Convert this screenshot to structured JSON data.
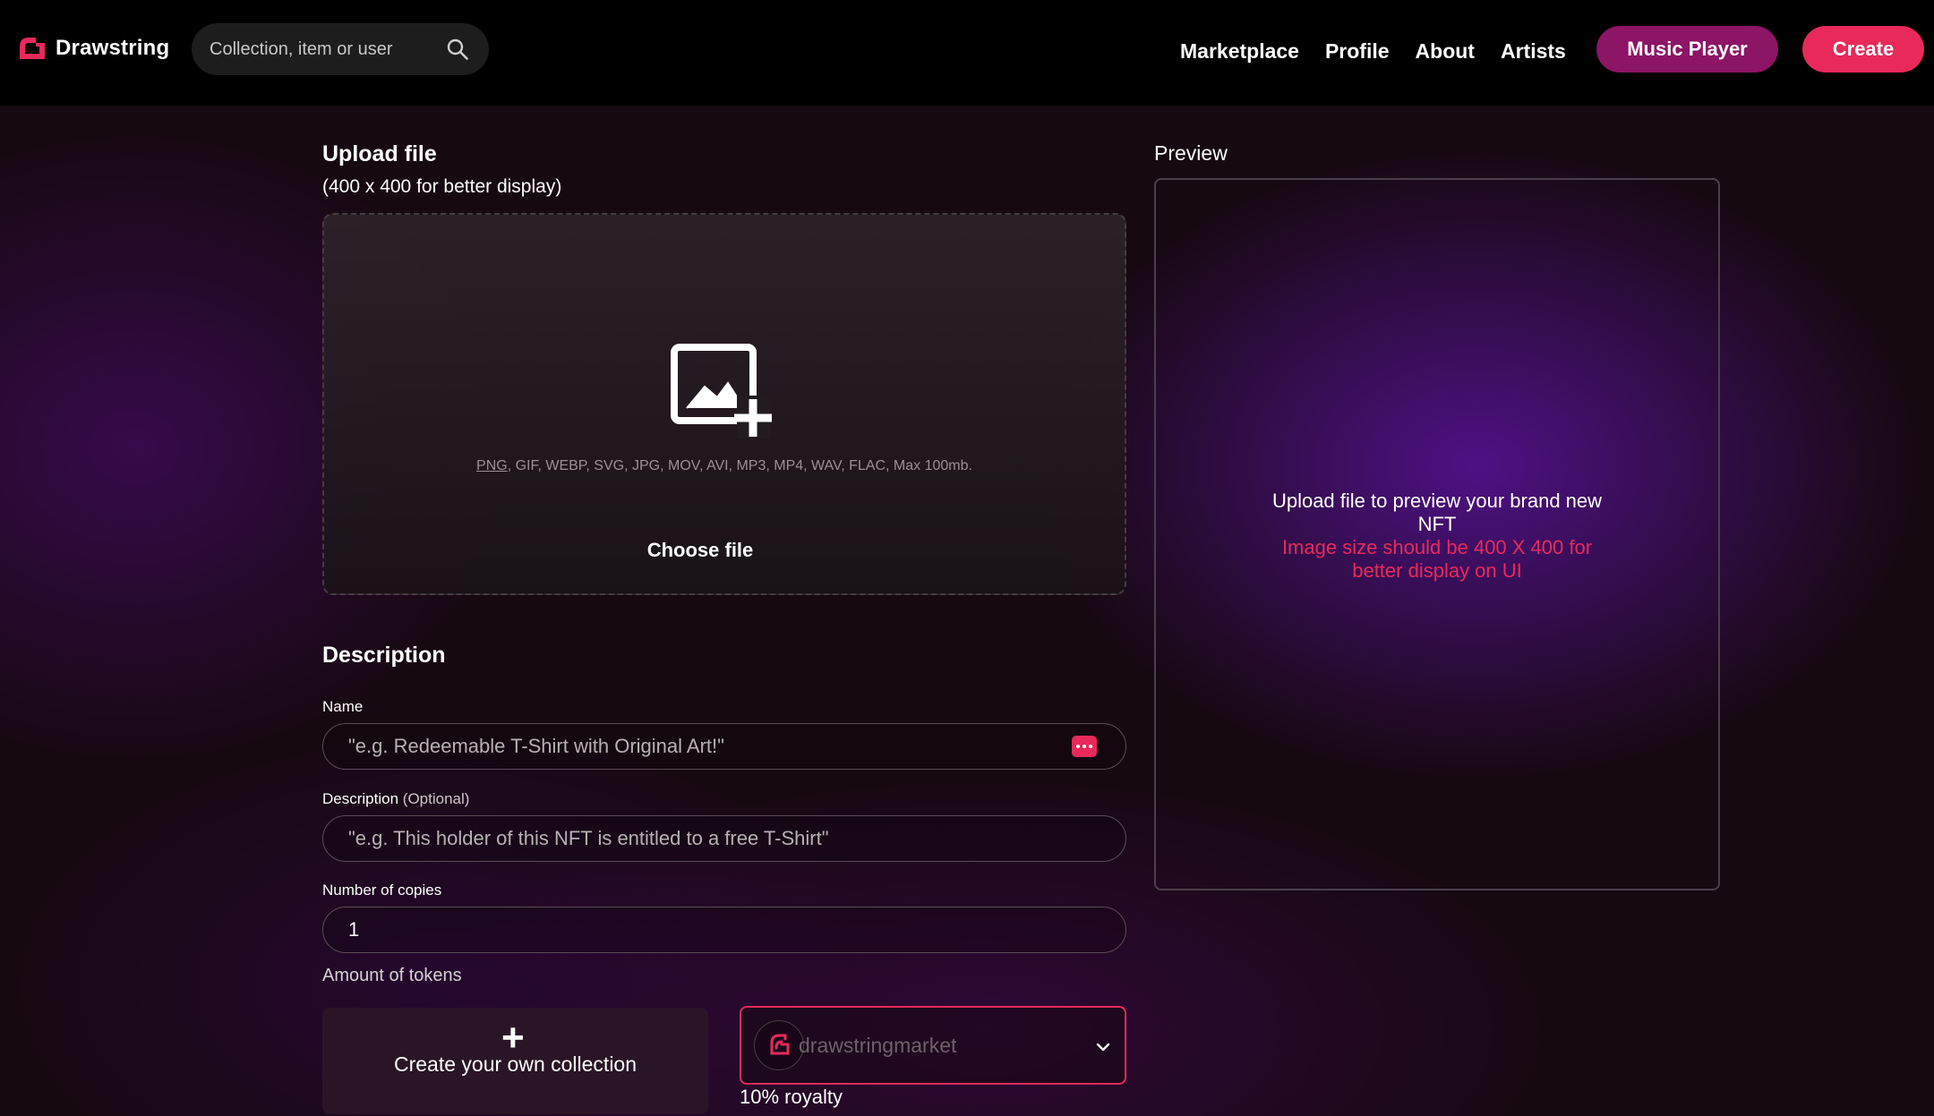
{
  "brand": {
    "name": "Drawstring",
    "accent": "#e8295a",
    "secondary": "#8c1566"
  },
  "search": {
    "placeholder": "Collection, item or user"
  },
  "nav": {
    "links": [
      "Marketplace",
      "Profile",
      "About",
      "Artists"
    ],
    "music_player": "Music Player",
    "create": "Create"
  },
  "upload": {
    "title": "Upload file",
    "subtitle": "(400 x 400 for better display)",
    "formats_first": "PNG",
    "formats_rest": ", GIF, WEBP, SVG, JPG, MOV, AVI, MP3, MP4, WAV, FLAC, Max 100mb.",
    "choose_file": "Choose file"
  },
  "description": {
    "title": "Description",
    "name_label": "Name",
    "name_placeholder": "\"e.g. Redeemable T-Shirt with Original Art!\"",
    "desc_label": "Description",
    "desc_optional": "(Optional)",
    "desc_placeholder": "\"e.g. This holder of this NFT is entitled to a free T-Shirt\"",
    "copies_label": "Number of copies",
    "copies_value": "1",
    "tokens_label": "Amount of tokens"
  },
  "collection": {
    "create_label": "Create your own collection",
    "selected": "drawstringmarket",
    "royalty": "10% royalty"
  },
  "preview": {
    "title": "Preview",
    "text": "Upload file to preview your brand new NFT",
    "warning": "Image size should be 400 X 400 for better display on UI"
  }
}
